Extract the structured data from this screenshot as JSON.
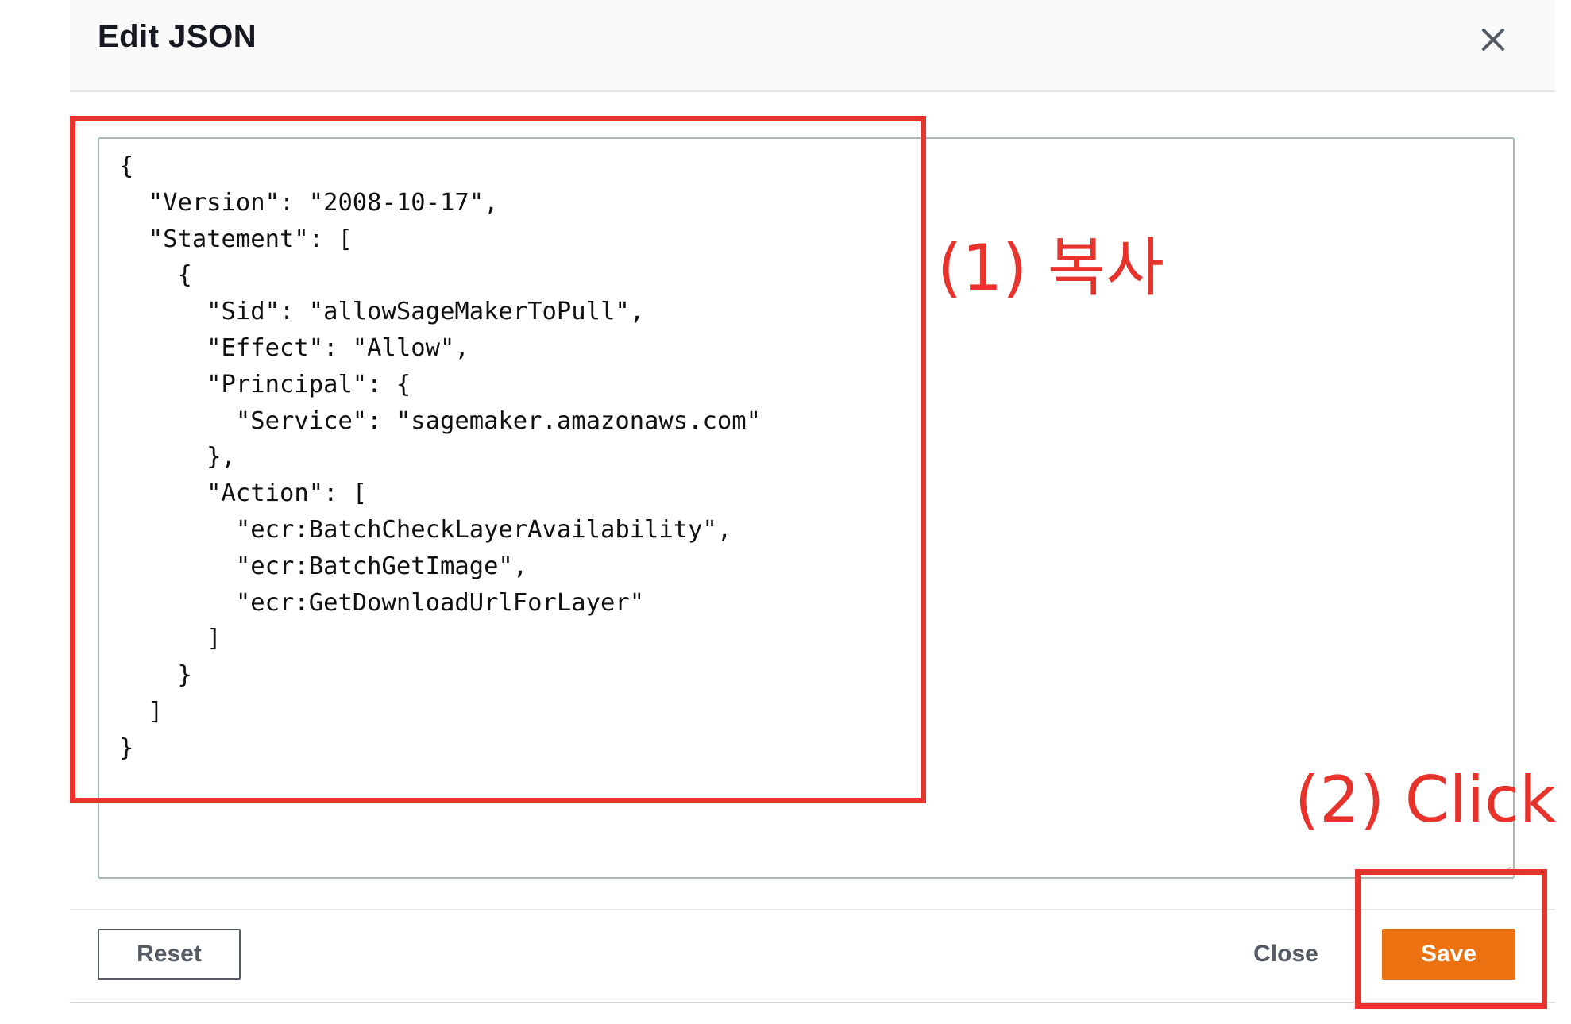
{
  "modal": {
    "title": "Edit JSON",
    "close_icon": "close-icon",
    "editor": {
      "lines": [
        "{",
        "  \"Version\": \"2008-10-17\",",
        "  \"Statement\": [",
        "    {",
        "      \"Sid\": \"allowSageMakerToPull\",",
        "      \"Effect\": \"Allow\",",
        "      \"Principal\": {",
        "        \"Service\": \"sagemaker.amazonaws.com\"",
        "      },",
        "      \"Action\": [",
        "        \"ecr:BatchCheckLayerAvailability\",",
        "        \"ecr:BatchGetImage\",",
        "        \"ecr:GetDownloadUrlForLayer\"",
        "      ]",
        "    }",
        "  ]",
        "}"
      ]
    },
    "footer": {
      "reset_label": "Reset",
      "close_label": "Close",
      "save_label": "Save"
    }
  },
  "annotations": {
    "step1_label": "(1) 복사",
    "step2_label": "(2) Click",
    "color": "#e8322c"
  },
  "colors": {
    "accent": "#ec7211",
    "header_bg": "#f9f9f9",
    "button_text": "#545b64"
  }
}
